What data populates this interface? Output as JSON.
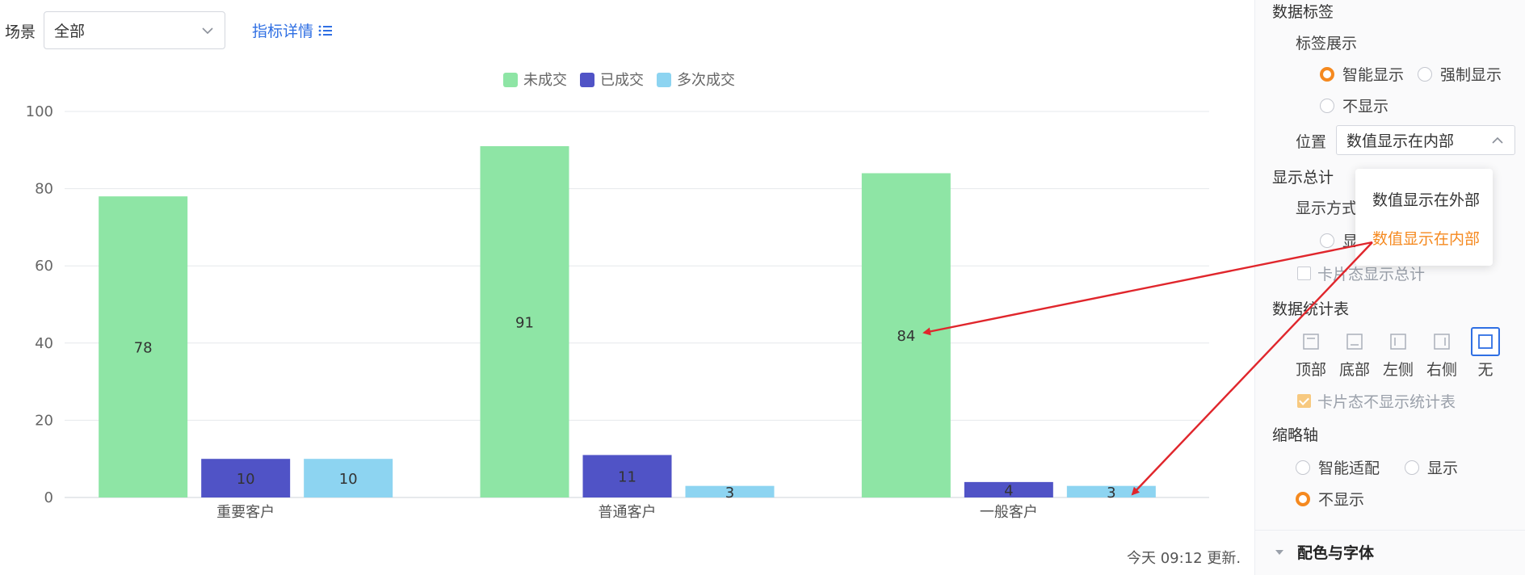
{
  "toolbar": {
    "scene_label": "场景",
    "scene_value": "全部",
    "metric_link": "指标详情"
  },
  "chart_data": {
    "type": "bar",
    "categories": [
      "重要客户",
      "普通客户",
      "一般客户"
    ],
    "series": [
      {
        "name": "未成交",
        "values": [
          78,
          91,
          84
        ],
        "color": "#8ee5a5"
      },
      {
        "name": "已成交",
        "values": [
          10,
          11,
          4
        ],
        "color": "#5053c6"
      },
      {
        "name": "多次成交",
        "values": [
          10,
          3,
          3
        ],
        "color": "#8dd4f1"
      }
    ],
    "ylim": [
      0,
      100
    ],
    "yticks": [
      "0",
      "20",
      "40",
      "60",
      "80",
      "100"
    ],
    "grid": true,
    "legend_position": "top-center",
    "data_labels": "inside"
  },
  "footer": {
    "updated_text": "今天 09:12 更新."
  },
  "panel": {
    "data_labels_title": "数据标签",
    "label_display_title": "标签展示",
    "label_display_options": [
      {
        "label": "智能显示",
        "selected": true
      },
      {
        "label": "强制显示",
        "selected": false
      },
      {
        "label": "不显示",
        "selected": false
      }
    ],
    "position_label": "位置",
    "position_value": "数值显示在内部",
    "position_options": [
      {
        "label": "数值显示在外部",
        "selected": false
      },
      {
        "label": "数值显示在内部",
        "selected": true
      }
    ],
    "show_total_title": "显示总计",
    "display_mode_label": "显示方式",
    "display_mode_option_partial": "显",
    "card_total_label": "卡片态显示总计",
    "stats_table_title": "数据统计表",
    "stats_table_options": [
      {
        "label": "顶部",
        "selected": false
      },
      {
        "label": "底部",
        "selected": false
      },
      {
        "label": "左侧",
        "selected": false
      },
      {
        "label": "右侧",
        "selected": false
      },
      {
        "label": "无",
        "selected": true
      }
    ],
    "card_no_stats_label": "卡片态不显示统计表",
    "axis_title": "缩略轴",
    "axis_options": [
      {
        "label": "智能适配",
        "selected": false
      },
      {
        "label": "显示",
        "selected": false
      },
      {
        "label": "不显示",
        "selected": true
      }
    ],
    "color_font_section": "配色与字体"
  },
  "colors": {
    "accent_orange": "#f5891f",
    "link_blue": "#2f6fe3",
    "arrow_red": "#e0262c"
  }
}
